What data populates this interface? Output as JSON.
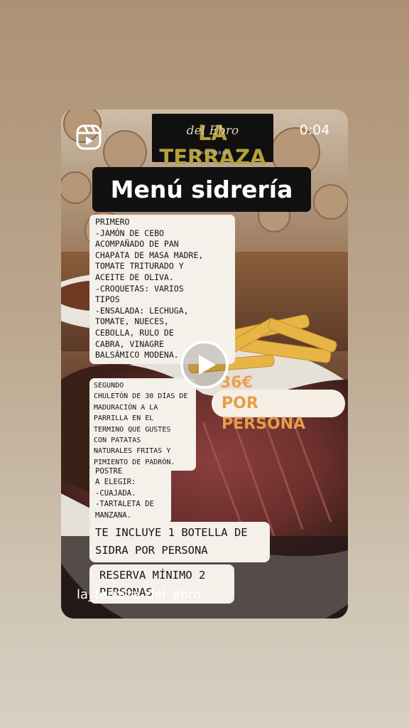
{
  "post": {
    "timer": "0:04",
    "username": "la_terraza_del_ebro"
  },
  "logo": {
    "name": "LA TERRAZA",
    "script": "del Ebro",
    "subtitle": "GASTROBAR"
  },
  "menu": {
    "title": "Menú sidrería",
    "primero": "PRIMERO\n-JAMÓN DE CEBO\nACOMPAÑADO DE PAN\nCHAPATA DE MASA MADRE,\nTOMATE TRITURADO Y\nACEITE DE OLIVA.\n-CROQUETAS: VARIOS\nTIPOS\n-ENSALADA: LECHUGA,\nTOMATE, NUECES,\nCEBOLLA, RULO DE\nCABRA, VINAGRE\nBALSÁMICO MODENA.",
    "segundo": "SEGUNDO\nCHULETÓN DE 30 DÍAS DE\nMADURACIÓN A LA\nPARRILLA EN EL\nTERMINO QUE GUSTES\nCON PATATAS\nNATURALES FRITAS Y\nPIMIENTO DE PADRÓN.",
    "postre": "POSTRE\nA ELEGIR:\n-CUAJADA.\n-TARTALETA DE\nMANZANA.",
    "sidra": "TE INCLUYE 1 BOTELLA DE\nSIDRA POR PERSONA",
    "reserva": "RESERVA MÍNIMO 2\nPERSONAS",
    "price": "36€",
    "price_unit": "POR PERSONA"
  },
  "icons": {
    "reels": "reels-icon",
    "play": "play-icon"
  },
  "colors": {
    "accent_price": "#e69b48",
    "logo_gold": "#b5a13b"
  }
}
